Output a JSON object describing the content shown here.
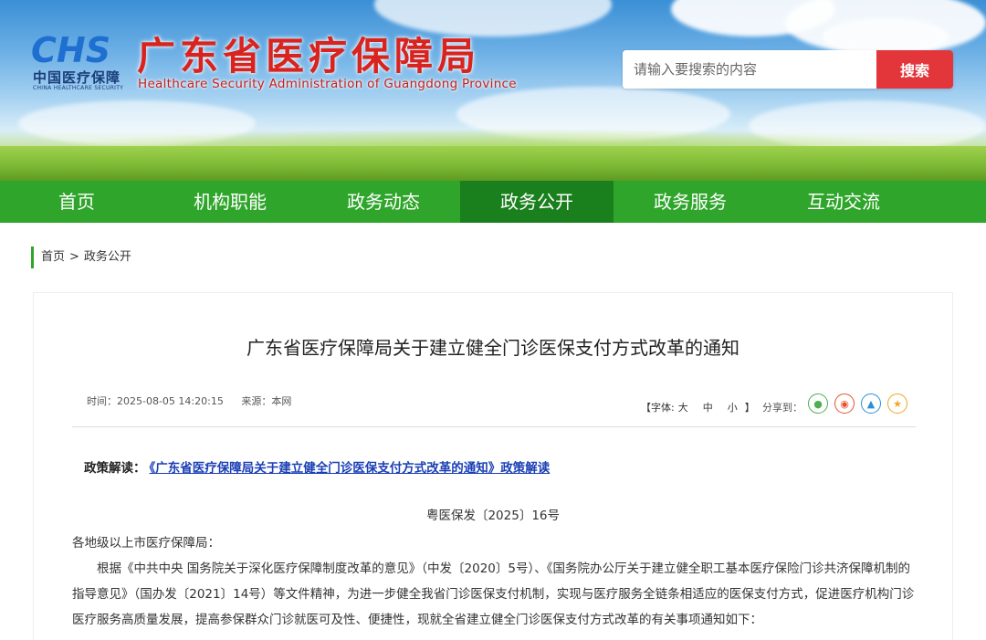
{
  "header": {
    "logo_cn": "中国医疗保障",
    "logo_en": "CHINA HEALTHCARE SECURITY",
    "logo_mark": "CHS",
    "title": "广东省医疗保障局",
    "subtitle": "Healthcare Security Administration of Guangdong Province",
    "search_placeholder": "请输入要搜索的内容",
    "search_button": "搜索"
  },
  "nav": {
    "items": [
      {
        "label": "首页"
      },
      {
        "label": "机构职能"
      },
      {
        "label": "政务动态"
      },
      {
        "label": "政务公开"
      },
      {
        "label": "政务服务"
      },
      {
        "label": "互动交流"
      }
    ],
    "active_index": 3
  },
  "breadcrumb": {
    "home": "首页",
    "sep": ">",
    "current": "政务公开"
  },
  "article": {
    "title": "广东省医疗保障局关于建立健全门诊医保支付方式改革的通知",
    "time": "时间：2025-08-05 14:20:15",
    "source": "来源：本网",
    "font_label": "【字体:",
    "font_large": "大",
    "font_medium": "中",
    "font_small": "小",
    "font_end": "】",
    "share_label": "分享到：",
    "share_icons": [
      "wechat-icon",
      "weibo-icon",
      "qq-icon",
      "qzone-icon"
    ],
    "interp_label": "政策解读：",
    "interp_link": "《广东省医疗保障局关于建立健全门诊医保支付方式改革的通知》政策解读",
    "doc_number": "粤医保发〔2025〕16号",
    "addressee": "各地级以上市医疗保障局：",
    "paragraph": "根据《中共中央 国务院关于深化医疗保障制度改革的意见》（中发〔2020〕5号）、《国务院办公厅关于建立健全职工基本医疗保险门诊共济保障机制的指导意见》（国办发〔2021〕14号）等文件精神，为进一步健全我省门诊医保支付机制，实现与医疗服务全链条相适应的医保支付方式，促进医疗机构门诊医疗服务高质量发展，提高参保群众门诊就医可及性、便捷性，现就全省建立健全门诊医保支付方式改革的有关事项通知如下："
  },
  "colors": {
    "nav_green": "#2fa52b",
    "nav_active": "#1a7f1d",
    "title_red": "#d8231f",
    "search_red": "#e2363b",
    "link_blue": "#1a3fb5"
  }
}
